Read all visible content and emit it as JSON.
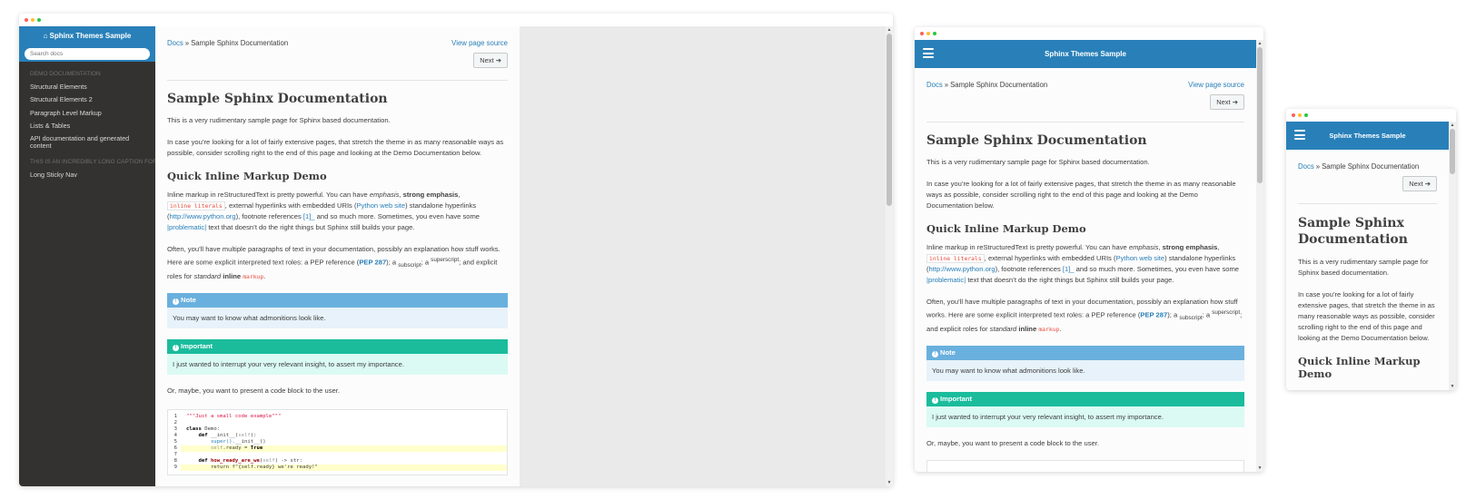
{
  "site": {
    "title": "Sphinx Themes Sample",
    "search_placeholder": "Search docs"
  },
  "sidebar": {
    "caption_1": "DEMO DOCUMENTATION",
    "items": [
      "Structural Elements",
      "Structural Elements 2",
      "Paragraph Level Markup",
      "Lists & Tables",
      "API documentation and generated content"
    ],
    "caption_2": "THIS IS AN INCREDIBLY LONG CAPTION FOR A LONG MENU",
    "items_2": [
      "Long Sticky Nav"
    ]
  },
  "breadcrumb": {
    "docs": "Docs",
    "separator": "»",
    "current": "Sample Sphinx Documentation",
    "view_source": "View page source"
  },
  "next_button": "Next",
  "page": {
    "title": "Sample Sphinx Documentation",
    "intro": "This is a very rudimentary sample page for Sphinx based documentation.",
    "para2": "In case you’re looking for a lot of fairly extensive pages, that stretch the theme in as many reasonable ways as possible, consider scrolling right to the end of this page and looking at the Demo Documentation below.",
    "section": "Quick Inline Markup Demo",
    "inline": {
      "p1_a": "Inline markup in reStructuredText is pretty powerful. You can have ",
      "emphasis": "emphasis",
      "comma": ", ",
      "strong": "strong emphasis",
      "literals": "inline literals",
      "p1_b": ", external hyperlinks with embedded URIs (",
      "python_link": "Python web site",
      "p1_c": ") standalone hyperlinks (",
      "url": "http://www.python.org",
      "p1_d": "), footnote references ",
      "footnote": "[1]_",
      "p1_e": " and so much more. Sometimes, you even have some ",
      "problematic": "|problematic|",
      "p1_f": " text that doesn’t do the right things but Sphinx still builds your page."
    },
    "roles": {
      "p2_a": "Often, you’ll have multiple paragraphs of text in your documentation, possibly an explanation how stuff works. Here are some explicit interpreted text roles: a PEP reference (",
      "pep": "PEP 287",
      "p2_b": "); a ",
      "subscript": "subscript",
      "p2_c": "; a ",
      "superscript": "superscript",
      "p2_d": "; and explicit roles for ",
      "standard": "standard",
      "space": " ",
      "inline_w": "inline",
      "markup": "markup",
      "period": "."
    },
    "note_title": "Note",
    "note_body": "You may want to know what admonitions look like.",
    "important_title": "Important",
    "important_body": "I just wanted to interrupt your very relevant insight, to assert my importance.",
    "code_intro": "Or, maybe, you want to present a code block to the user."
  },
  "code": {
    "line_numbers": [
      "1",
      "2",
      "3",
      "4",
      "5",
      "6",
      "7",
      "8",
      "9"
    ],
    "l1": "\"\"\"Just a small code example\"\"\"",
    "l3_kw": "class",
    "l3_rest": " Demo:",
    "l4_a": "    def ",
    "l4_b": "__init__",
    "l4_c": "(",
    "l4_self": "self",
    "l4_d": "):",
    "l5_a": "        super().",
    "l5_b": "__init__",
    "l5_c": "()",
    "l6_self": "        self",
    "l6_b": ".ready = ",
    "l6_true": "True",
    "l8_a": "    def ",
    "l8_b": "how_ready_are_we",
    "l8_c": "(",
    "l8_self": "self",
    "l8_d": ") -> str:",
    "l9": "        return f\"{self.ready} we're ready!\""
  },
  "icons": {
    "home": "⌂",
    "next_arrow": "➔",
    "info": "!"
  },
  "colors": {
    "brand_blue": "#2980b9",
    "sidebar_bg": "#343131",
    "note_header": "#6ab0de",
    "important_header": "#1abc9c",
    "link": "#2980b9"
  }
}
